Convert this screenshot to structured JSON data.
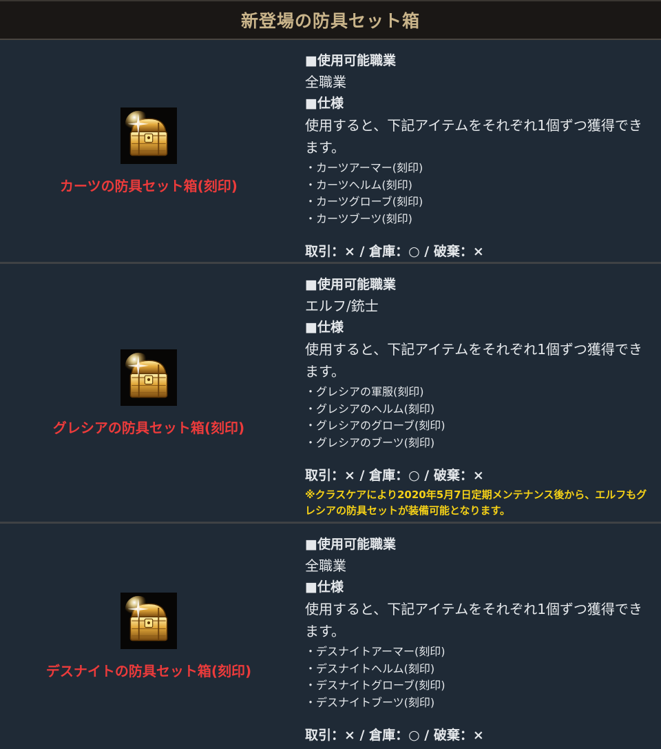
{
  "header": {
    "title": "新登場の防具セット箱"
  },
  "colors": {
    "item_name": "#ec3b3b",
    "note": "#f5d117",
    "header_title": "#c9b48a",
    "row_bg": "#1f2a36"
  },
  "rows": [
    {
      "item_icon": "treasure-chest-icon",
      "item_name": "カーツの防具セット箱(刻印)",
      "job_heading": "■使用可能職業",
      "job": "全職業",
      "spec_heading": "■仕様",
      "description": "使用すると、下記アイテムをそれぞれ1個ずつ獲得できます。",
      "items": [
        "・カーツアーマー(刻印)",
        "・カーツヘルム(刻印)",
        "・カーツグローブ(刻印)",
        "・カーツブーツ(刻印)"
      ],
      "trade": "取引：× / 倉庫：○ / 破棄：×"
    },
    {
      "item_icon": "treasure-chest-icon",
      "item_name": "グレシアの防具セット箱(刻印)",
      "job_heading": "■使用可能職業",
      "job": "エルフ/銃士",
      "spec_heading": "■仕様",
      "description": "使用すると、下記アイテムをそれぞれ1個ずつ獲得できます。",
      "items": [
        "・グレシアの軍服(刻印)",
        "・グレシアのヘルム(刻印)",
        "・グレシアのグローブ(刻印)",
        "・グレシアのブーツ(刻印)"
      ],
      "trade": "取引：× / 倉庫：○ / 破棄：×",
      "note": "※クラスケアにより2020年5月7日定期メンテナンス後から、エルフもグレシアの防具セットが装備可能となります。"
    },
    {
      "item_icon": "treasure-chest-icon",
      "item_name": "デスナイトの防具セット箱(刻印)",
      "job_heading": "■使用可能職業",
      "job": "全職業",
      "spec_heading": "■仕様",
      "description": "使用すると、下記アイテムをそれぞれ1個ずつ獲得できます。",
      "items": [
        "・デスナイトアーマー(刻印)",
        "・デスナイトヘルム(刻印)",
        "・デスナイトグローブ(刻印)",
        "・デスナイトブーツ(刻印)"
      ],
      "trade": "取引：× / 倉庫：○ / 破棄：×"
    }
  ]
}
